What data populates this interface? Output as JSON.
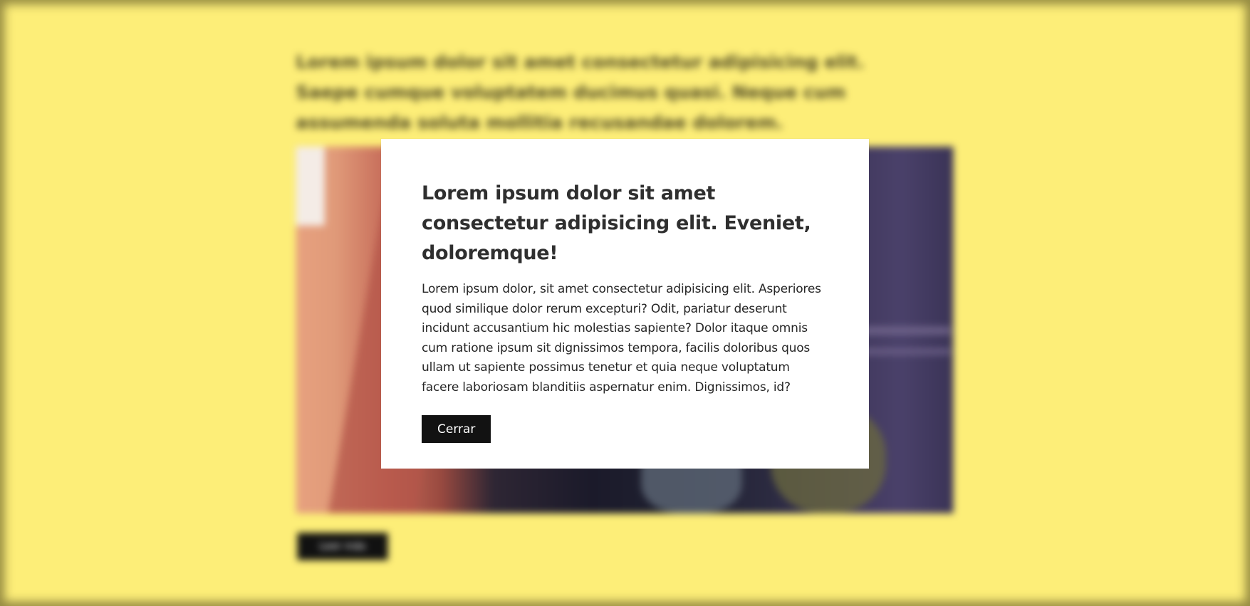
{
  "background_page": {
    "intro_text": "Lorem ipsum dolor sit amet consectetur adipisicing elit. Saepe cumque voluptatem ducimus quasi. Neque cum assumenda soluta mollitia recusandae dolorem.",
    "open_button_label": "Leer más"
  },
  "modal": {
    "title": "Lorem ipsum dolor sit amet consectetur adipisicing elit. Eveniet, doloremque!",
    "body": "Lorem ipsum dolor, sit amet consectetur adipisicing elit. Asperiores quod similique dolor rerum excepturi? Odit, pariatur deserunt incidunt accusantium hic molestias sapiente? Dolor itaque omnis cum ratione ipsum sit dignissimos tempora, facilis doloribus quos ullam ut sapiente possimus tenetur et quia neque voluptatum facere laboriosam blanditiis aspernatur enim. Dignissimos, id?",
    "close_label": "Cerrar"
  },
  "colors": {
    "page_background": "#fdee78",
    "modal_background": "#ffffff",
    "button_background": "#121212",
    "button_text": "#ffffff"
  }
}
